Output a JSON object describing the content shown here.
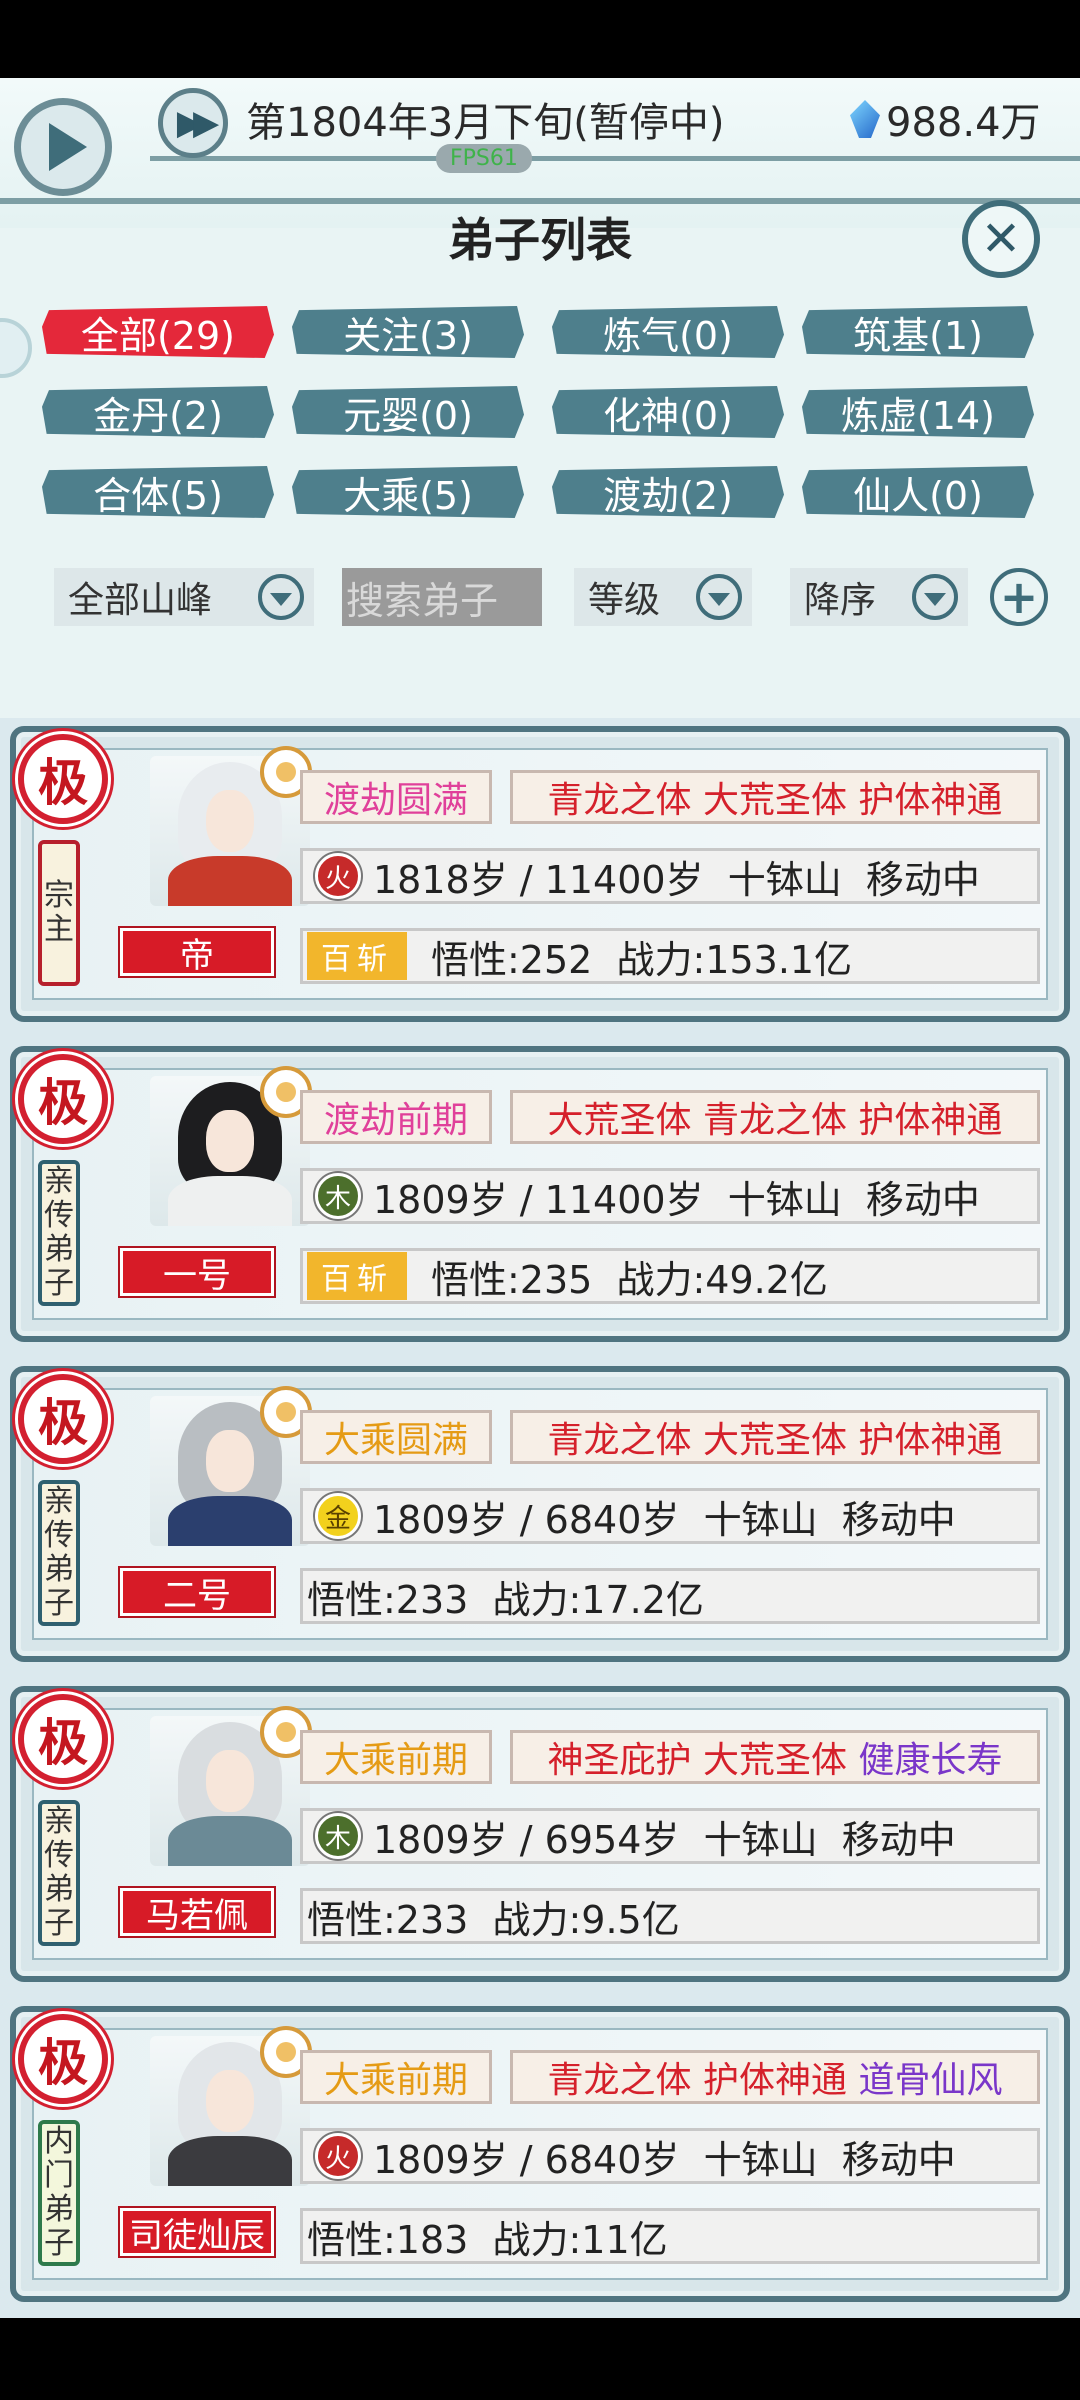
{
  "header": {
    "date": "第1804年3月下旬(暂停中)",
    "fps": "FPS61",
    "money": "988.4万"
  },
  "title": "弟子列表",
  "filters": [
    {
      "label": "全部(29)",
      "active": true
    },
    {
      "label": "关注(3)"
    },
    {
      "label": "炼气(0)"
    },
    {
      "label": "筑基(1)"
    },
    {
      "label": "金丹(2)"
    },
    {
      "label": "元婴(0)"
    },
    {
      "label": "化神(0)"
    },
    {
      "label": "炼虚(14)"
    },
    {
      "label": "合体(5)"
    },
    {
      "label": "大乘(5)"
    },
    {
      "label": "渡劫(2)"
    },
    {
      "label": "仙人(0)"
    }
  ],
  "controls": {
    "mountain": "全部山峰",
    "search_placeholder": "搜索弟子",
    "sort_field": "等级",
    "sort_order": "降序"
  },
  "disciples": [
    {
      "seal": "极",
      "rank": [
        "宗",
        "主"
      ],
      "name": "帝",
      "realm": "渡劫圆满",
      "traits": "青龙之体 大荒圣体 护体神通",
      "traits_extra": "",
      "element": "火",
      "age": "1818岁 / 11400岁",
      "location": "十钵山",
      "status": "移动中",
      "badge": "百斩",
      "stats": "悟性:252  战力:153.1亿"
    },
    {
      "seal": "极",
      "rank": [
        "亲",
        "传",
        "弟",
        "子"
      ],
      "name": "一号",
      "realm": "渡劫前期",
      "traits": "大荒圣体 青龙之体 护体神通",
      "traits_extra": "",
      "element": "木",
      "age": "1809岁 / 11400岁",
      "location": "十钵山",
      "status": "移动中",
      "badge": "百斩",
      "stats": "悟性:235  战力:49.2亿"
    },
    {
      "seal": "极",
      "rank": [
        "亲",
        "传",
        "弟",
        "子"
      ],
      "name": "二号",
      "realm": "大乘圆满",
      "traits": "青龙之体 大荒圣体 护体神通",
      "traits_extra": "",
      "element": "金",
      "age": "1809岁 / 6840岁",
      "location": "十钵山",
      "status": "移动中",
      "badge": "",
      "stats": "悟性:233  战力:17.2亿"
    },
    {
      "seal": "极",
      "rank": [
        "亲",
        "传",
        "弟",
        "子"
      ],
      "name": "马若佩",
      "realm": "大乘前期",
      "traits": "神圣庇护 大荒圣体 ",
      "traits_extra": "健康长寿",
      "element": "木",
      "age": "1809岁 / 6954岁",
      "location": "十钵山",
      "status": "移动中",
      "badge": "",
      "stats": "悟性:233  战力:9.5亿"
    },
    {
      "seal": "极",
      "rank": [
        "内",
        "门",
        "弟",
        "子"
      ],
      "name": "司徒灿辰",
      "realm": "大乘前期",
      "traits": "青龙之体 护体神通 ",
      "traits_extra": "道骨仙风",
      "element": "火",
      "age": "1809岁 / 6840岁",
      "location": "十钵山",
      "status": "移动中",
      "badge": "",
      "stats": "悟性:183  战力:11亿"
    }
  ]
}
